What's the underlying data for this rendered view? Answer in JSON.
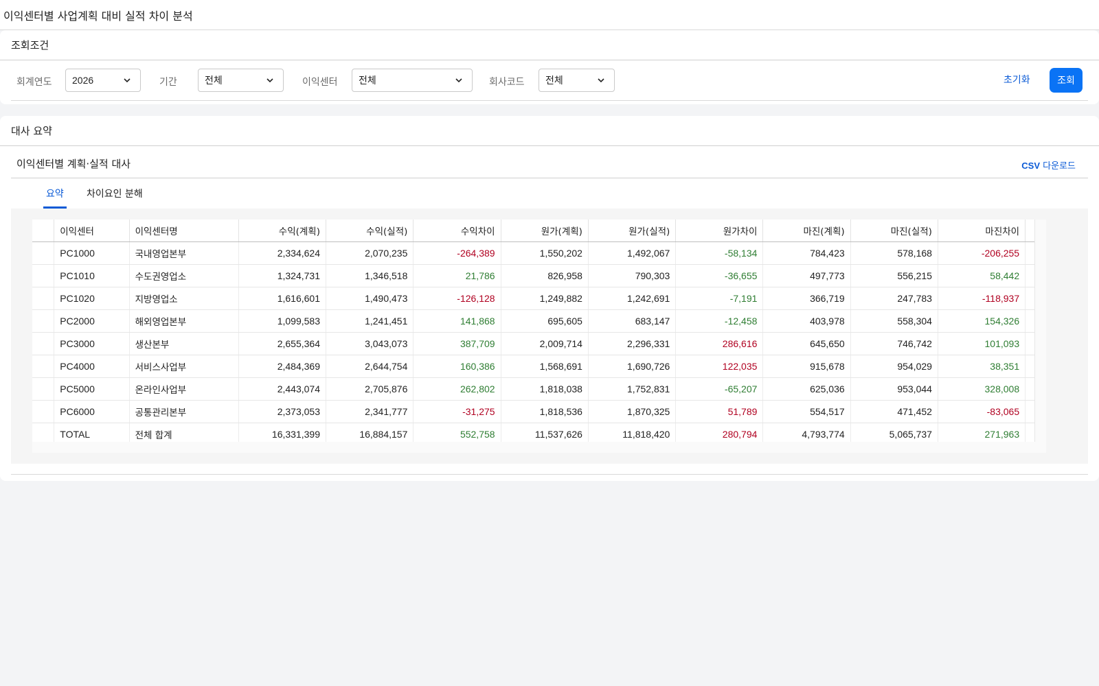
{
  "page": {
    "title": "이익센터별 사업계획 대비 실적 차이 분석"
  },
  "filters": {
    "title": "조회조건",
    "fiscal_year": {
      "label": "회계연도",
      "value": "2026"
    },
    "period": {
      "label": "기간",
      "value": "전체"
    },
    "profit_center": {
      "label": "이익센터",
      "value": "전체"
    },
    "company_code": {
      "label": "회사코드",
      "value": "전체"
    },
    "reset_label": "초기화",
    "query_label": "조회"
  },
  "summary": {
    "title": "대사 요약",
    "subtitle": "이익센터별 계획·실적 대사",
    "csv_prefix": "CSV",
    "csv_label": " 다운로드",
    "tabs": [
      {
        "label": "요약"
      },
      {
        "label": "차이요인 분해"
      }
    ],
    "columns": [
      "이익센터",
      "이익센터명",
      "수익(계획)",
      "수익(실적)",
      "수익차이",
      "원가(계획)",
      "원가(실적)",
      "원가차이",
      "마진(계획)",
      "마진(실적)",
      "마진차이"
    ],
    "rows": [
      [
        "PC1000",
        "국내영업본부",
        "2,334,624",
        "2,070,235",
        "-264,389",
        "1,550,202",
        "1,492,067",
        "-58,134",
        "784,423",
        "578,168",
        "-206,255"
      ],
      [
        "PC1010",
        "수도권영업소",
        "1,324,731",
        "1,346,518",
        "21,786",
        "826,958",
        "790,303",
        "-36,655",
        "497,773",
        "556,215",
        "58,442"
      ],
      [
        "PC1020",
        "지방영업소",
        "1,616,601",
        "1,490,473",
        "-126,128",
        "1,249,882",
        "1,242,691",
        "-7,191",
        "366,719",
        "247,783",
        "-118,937"
      ],
      [
        "PC2000",
        "해외영업본부",
        "1,099,583",
        "1,241,451",
        "141,868",
        "695,605",
        "683,147",
        "-12,458",
        "403,978",
        "558,304",
        "154,326"
      ],
      [
        "PC3000",
        "생산본부",
        "2,655,364",
        "3,043,073",
        "387,709",
        "2,009,714",
        "2,296,331",
        "286,616",
        "645,650",
        "746,742",
        "101,093"
      ],
      [
        "PC4000",
        "서비스사업부",
        "2,484,369",
        "2,644,754",
        "160,386",
        "1,568,691",
        "1,690,726",
        "122,035",
        "915,678",
        "954,029",
        "38,351"
      ],
      [
        "PC5000",
        "온라인사업부",
        "2,443,074",
        "2,705,876",
        "262,802",
        "1,818,038",
        "1,752,831",
        "-65,207",
        "625,036",
        "953,044",
        "328,008"
      ],
      [
        "PC6000",
        "공통관리본부",
        "2,373,053",
        "2,341,777",
        "-31,275",
        "1,818,536",
        "1,870,325",
        "51,789",
        "554,517",
        "471,452",
        "-83,065"
      ],
      [
        "TOTAL",
        "전체 합계",
        "16,331,399",
        "16,884,157",
        "552,758",
        "11,537,626",
        "11,818,420",
        "280,794",
        "4,793,774",
        "5,065,737",
        "271,963"
      ]
    ],
    "colors": {
      "negative_good": "#2e7d32",
      "bad": "#b00020",
      "accent": "#0a73f5"
    }
  }
}
